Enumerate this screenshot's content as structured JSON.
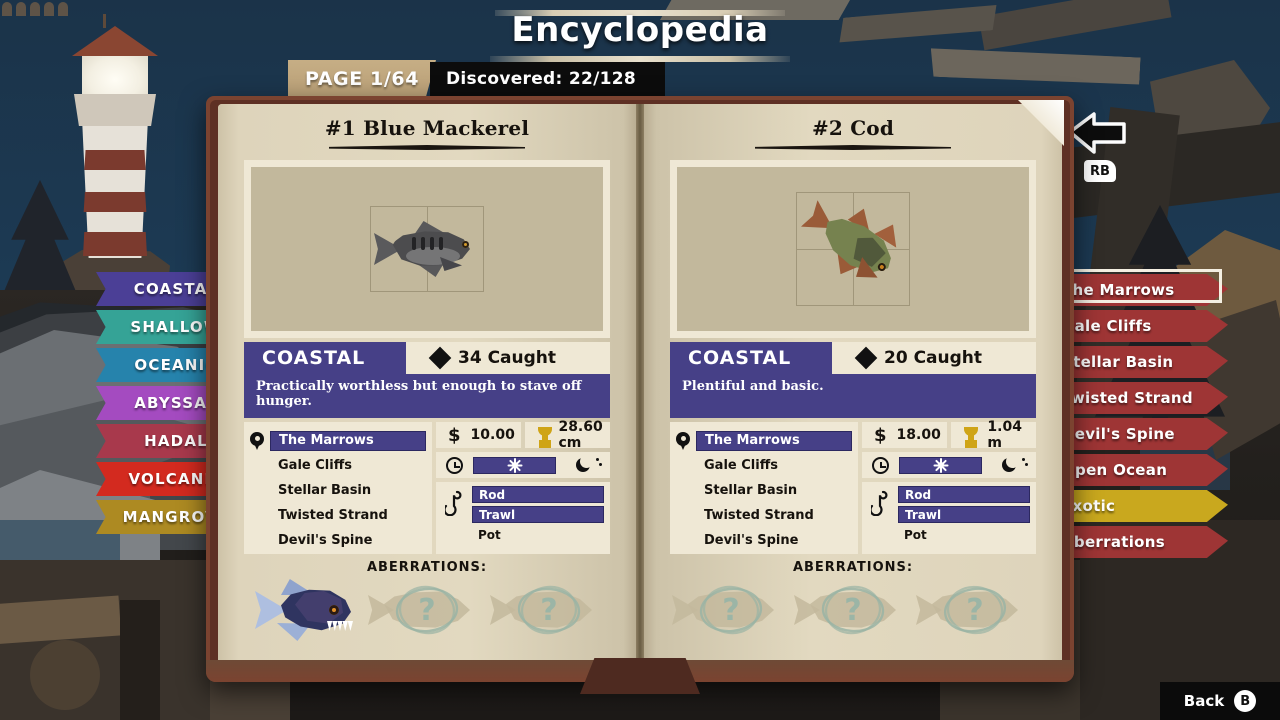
{
  "header": {
    "title": "Encyclopedia",
    "page_label": "PAGE 1/64",
    "discovered_label": "Discovered: 22/128"
  },
  "hints": {
    "rb_key": "RB",
    "back_label": "Back",
    "back_button": "B"
  },
  "colors": {
    "biome_purple": "#464087",
    "panel_cream": "#efe8d5",
    "page_paper": "#ded4bb",
    "book_cover": "#7b4330",
    "region_tab_red": "#9e3535",
    "region_tab_gold": "#c9a81e"
  },
  "left_tabs": [
    {
      "label": "COASTAL",
      "color": "#4b3f96"
    },
    {
      "label": "SHALLOW",
      "color": "#35a396"
    },
    {
      "label": "OCEANIC",
      "color": "#2683ac"
    },
    {
      "label": "ABYSSAL",
      "color": "#a44bc0"
    },
    {
      "label": "HADAL",
      "color": "#a8394c"
    },
    {
      "label": "VOLCANIC",
      "color": "#d32a1f"
    },
    {
      "label": "MANGROVE",
      "color": "#ad8a22"
    }
  ],
  "right_tabs": [
    {
      "label": "The Marrows",
      "color": "#9e3535",
      "selected": true
    },
    {
      "label": "Gale Cliffs",
      "color": "#9e3535",
      "selected": false
    },
    {
      "label": "Stellar Basin",
      "color": "#9e3535",
      "selected": false
    },
    {
      "label": "Twisted Strand",
      "color": "#9e3535",
      "selected": false
    },
    {
      "label": "Devil's Spine",
      "color": "#9e3535",
      "selected": false
    },
    {
      "label": "Open Ocean",
      "color": "#9e3535",
      "selected": false
    },
    {
      "label": "Exotic",
      "color": "#c9a81e",
      "selected": false
    },
    {
      "label": "Aberrations",
      "color": "#9e3535",
      "selected": false
    }
  ],
  "entries": [
    {
      "title": "#1 Blue Mackerel",
      "biome": "COASTAL",
      "caught": "34 Caught",
      "description": "Practically worthless but enough to stave off hunger.",
      "locations": [
        {
          "name": "The Marrows",
          "active": true
        },
        {
          "name": "Gale Cliffs",
          "active": false
        },
        {
          "name": "Stellar Basin",
          "active": false
        },
        {
          "name": "Twisted Strand",
          "active": false
        },
        {
          "name": "Devil's Spine",
          "active": false
        }
      ],
      "price": "10.00",
      "record": "28.60 cm",
      "time_day_active": true,
      "time_night_active": false,
      "gear": [
        {
          "name": "Rod",
          "active": true
        },
        {
          "name": "Trawl",
          "active": true
        },
        {
          "name": "Pot",
          "active": false
        }
      ],
      "aberrations_label": "ABERRATIONS:",
      "aberrations": [
        {
          "discovered": true,
          "mark": ""
        },
        {
          "discovered": false,
          "mark": "?"
        },
        {
          "discovered": false,
          "mark": "?"
        }
      ]
    },
    {
      "title": "#2 Cod",
      "biome": "COASTAL",
      "caught": "20 Caught",
      "description": "Plentiful and basic.",
      "locations": [
        {
          "name": "The Marrows",
          "active": true
        },
        {
          "name": "Gale Cliffs",
          "active": false
        },
        {
          "name": "Stellar Basin",
          "active": false
        },
        {
          "name": "Twisted Strand",
          "active": false
        },
        {
          "name": "Devil's Spine",
          "active": false
        }
      ],
      "price": "18.00",
      "record": "1.04 m",
      "time_day_active": true,
      "time_night_active": false,
      "gear": [
        {
          "name": "Rod",
          "active": true
        },
        {
          "name": "Trawl",
          "active": true
        },
        {
          "name": "Pot",
          "active": false
        }
      ],
      "aberrations_label": "ABERRATIONS:",
      "aberrations": [
        {
          "discovered": false,
          "mark": "?"
        },
        {
          "discovered": false,
          "mark": "?"
        },
        {
          "discovered": false,
          "mark": "?"
        }
      ]
    }
  ],
  "icons": {
    "currency": "$",
    "pin": "location-pin-icon",
    "trophy": "trophy-icon",
    "clock": "clock-icon",
    "sun": "sun-icon",
    "moon": "moon-icon",
    "hook": "fishing-hook-icon",
    "diamond": "diamond-icon"
  }
}
